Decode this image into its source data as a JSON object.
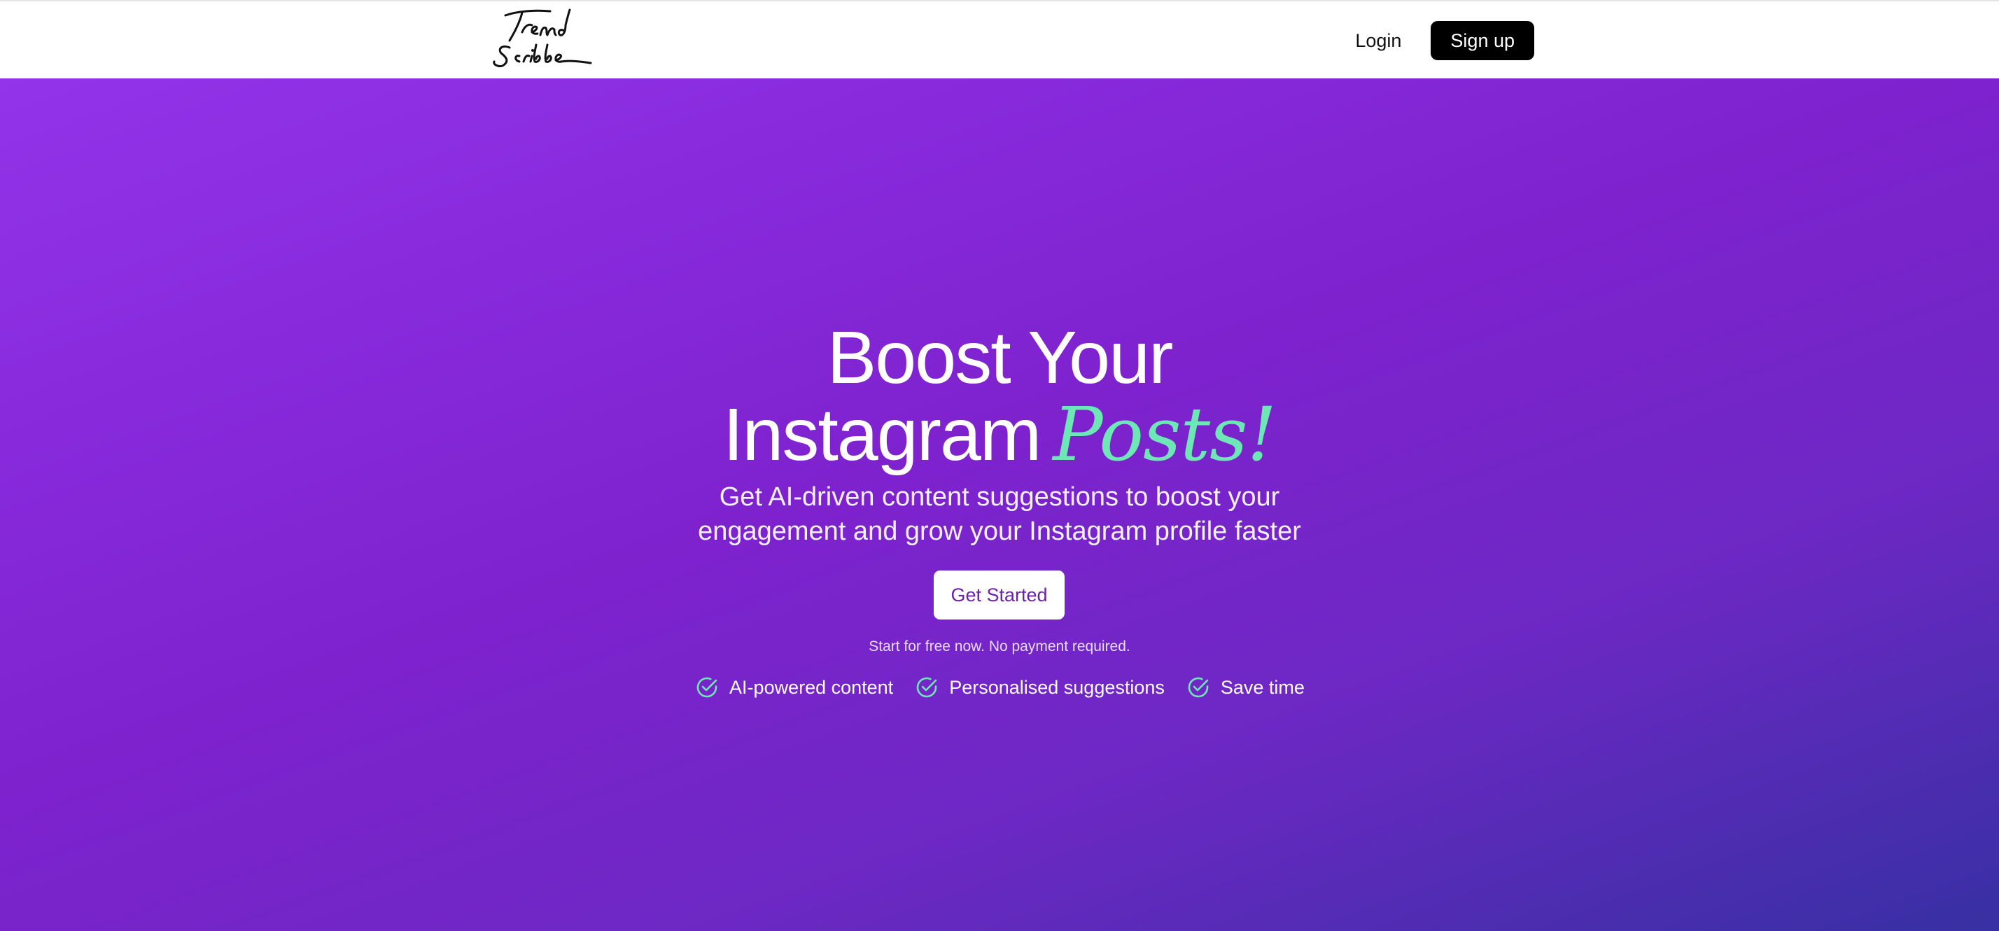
{
  "header": {
    "logo_text": "Trend Scribbe",
    "login_label": "Login",
    "signup_label": "Sign up"
  },
  "hero": {
    "title_line1": "Boost Your",
    "title_line2": "Instagram",
    "title_accent": "Posts!",
    "subtitle_line1": "Get AI-driven content suggestions to boost your",
    "subtitle_line2": "engagement and grow your Instagram profile faster",
    "cta_label": "Get Started",
    "cta_note": "Start for free now. No payment required.",
    "features": [
      {
        "label": "AI-powered content",
        "icon": "check-circle-icon"
      },
      {
        "label": "Personalised suggestions",
        "icon": "check-circle-icon"
      },
      {
        "label": "Save time",
        "icon": "check-circle-icon"
      }
    ]
  },
  "colors": {
    "accent_green": "#6ee7b7",
    "gradient_start": "#9333ea",
    "gradient_end": "#3730a3",
    "signup_bg": "#000000",
    "cta_text": "#6b21a8"
  }
}
